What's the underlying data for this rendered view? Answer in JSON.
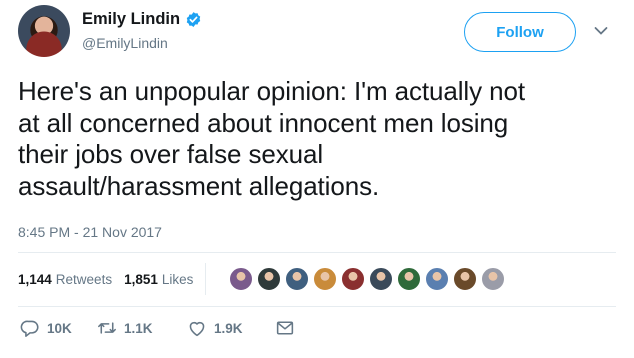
{
  "author": {
    "display_name": "Emily Lindin",
    "handle": "@EmilyLindin",
    "verified": true
  },
  "follow_label": "Follow",
  "tweet": {
    "lines": [
      "Here's an unpopular opinion: I'm actually not",
      "at all concerned about innocent men losing",
      "their jobs over false sexual",
      "assault/harassment allegations."
    ],
    "timestamp": "8:45 PM - 21 Nov 2017"
  },
  "stats": {
    "retweets_count": "1,144",
    "retweets_label": "Retweets",
    "likes_count": "1,851",
    "likes_label": "Likes"
  },
  "likers": [
    {
      "icon": "user-avatar",
      "color": "#7a5a8c"
    },
    {
      "icon": "user-avatar",
      "color": "#2f3a3a"
    },
    {
      "icon": "user-avatar",
      "color": "#3f5f7f"
    },
    {
      "icon": "user-avatar",
      "color": "#c98b3a"
    },
    {
      "icon": "user-avatar",
      "color": "#8a2f2f"
    },
    {
      "icon": "user-avatar",
      "color": "#3a4a5a"
    },
    {
      "icon": "user-avatar",
      "color": "#2f6a3a"
    },
    {
      "icon": "user-avatar",
      "color": "#5a7fb0"
    },
    {
      "icon": "user-avatar",
      "color": "#6a4a2a"
    },
    {
      "icon": "user-avatar",
      "color": "#9a9ca8"
    }
  ],
  "actions": {
    "reply_count": "10K",
    "retweet_count": "1.1K",
    "like_count": "1.9K"
  },
  "colors": {
    "accent": "#1da1f2",
    "text": "#14171a",
    "muted": "#657786",
    "divider": "#e6ecf0"
  }
}
